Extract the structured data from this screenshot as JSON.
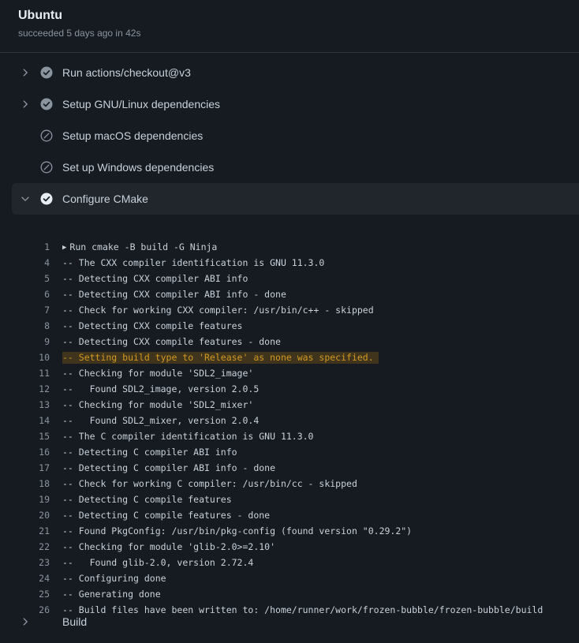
{
  "job": {
    "title": "Ubuntu",
    "subtitle": "succeeded 5 days ago in 42s"
  },
  "steps": [
    {
      "label": "Run actions/checkout@v3",
      "status": "success",
      "expanded": false,
      "collapsible": true
    },
    {
      "label": "Setup GNU/Linux dependencies",
      "status": "success",
      "expanded": false,
      "collapsible": true
    },
    {
      "label": "Setup macOS dependencies",
      "status": "skipped",
      "expanded": false,
      "collapsible": false
    },
    {
      "label": "Set up Windows dependencies",
      "status": "skipped",
      "expanded": false,
      "collapsible": false
    },
    {
      "label": "Configure CMake",
      "status": "success",
      "expanded": true,
      "collapsible": true
    }
  ],
  "log": [
    {
      "n": "1",
      "text": "Run cmake -B build -G Ninja",
      "group": true
    },
    {
      "n": "4",
      "text": "-- The CXX compiler identification is GNU 11.3.0"
    },
    {
      "n": "5",
      "text": "-- Detecting CXX compiler ABI info"
    },
    {
      "n": "6",
      "text": "-- Detecting CXX compiler ABI info - done"
    },
    {
      "n": "7",
      "text": "-- Check for working CXX compiler: /usr/bin/c++ - skipped"
    },
    {
      "n": "8",
      "text": "-- Detecting CXX compile features"
    },
    {
      "n": "9",
      "text": "-- Detecting CXX compile features - done"
    },
    {
      "n": "10",
      "text": "-- Setting build type to 'Release' as none was specified.",
      "warn": true
    },
    {
      "n": "11",
      "text": "-- Checking for module 'SDL2_image'"
    },
    {
      "n": "12",
      "text": "--   Found SDL2_image, version 2.0.5"
    },
    {
      "n": "13",
      "text": "-- Checking for module 'SDL2_mixer'"
    },
    {
      "n": "14",
      "text": "--   Found SDL2_mixer, version 2.0.4"
    },
    {
      "n": "15",
      "text": "-- The C compiler identification is GNU 11.3.0"
    },
    {
      "n": "16",
      "text": "-- Detecting C compiler ABI info"
    },
    {
      "n": "17",
      "text": "-- Detecting C compiler ABI info - done"
    },
    {
      "n": "18",
      "text": "-- Check for working C compiler: /usr/bin/cc - skipped"
    },
    {
      "n": "19",
      "text": "-- Detecting C compile features"
    },
    {
      "n": "20",
      "text": "-- Detecting C compile features - done"
    },
    {
      "n": "21",
      "text": "-- Found PkgConfig: /usr/bin/pkg-config (found version \"0.29.2\")"
    },
    {
      "n": "22",
      "text": "-- Checking for module 'glib-2.0>=2.10'"
    },
    {
      "n": "23",
      "text": "--   Found glib-2.0, version 2.72.4"
    },
    {
      "n": "24",
      "text": "-- Configuring done"
    },
    {
      "n": "25",
      "text": "-- Generating done"
    },
    {
      "n": "26",
      "text": "-- Build files have been written to: /home/runner/work/frozen-bubble/frozen-bubble/build"
    }
  ],
  "after_steps": [
    {
      "label": "Build",
      "status": "pending",
      "expanded": false,
      "collapsible": true
    }
  ],
  "colors": {
    "background": "#161b22",
    "text": "#c9d1d9",
    "muted": "#8b949e",
    "success_icon": "#8b949e",
    "warning": "#d29922"
  }
}
